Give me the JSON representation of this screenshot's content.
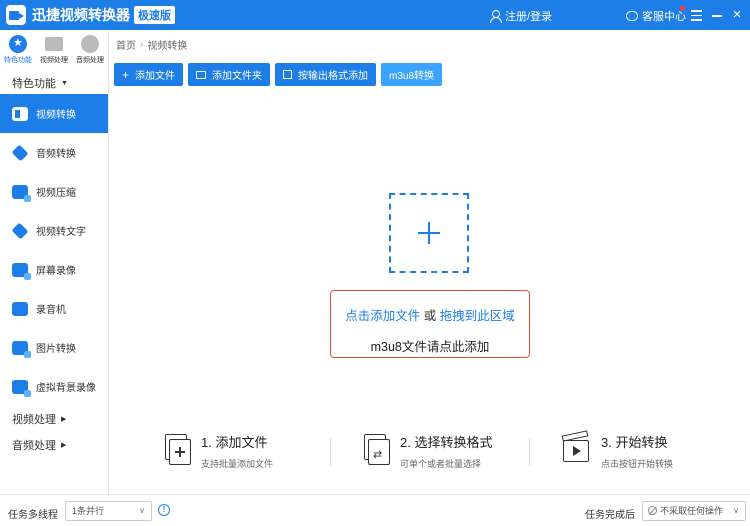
{
  "app": {
    "title": "迅捷视频转换器",
    "edition": "极速版",
    "login": "注册/登录",
    "service": "客服中心",
    "close": "×"
  },
  "sidebar": {
    "top_tabs": [
      {
        "label": "特色功能",
        "active": true
      },
      {
        "label": "视频处理",
        "active": false
      },
      {
        "label": "音频处理",
        "active": false
      }
    ],
    "section_featured": "特色功能",
    "items": [
      {
        "label": "视频转换",
        "icon": "video-convert-icon",
        "active": true
      },
      {
        "label": "音频转换",
        "icon": "audio-convert-icon",
        "active": false
      },
      {
        "label": "视频压缩",
        "icon": "video-compress-icon",
        "active": false
      },
      {
        "label": "视频转文字",
        "icon": "video-to-text-icon",
        "active": false
      },
      {
        "label": "屏幕录像",
        "icon": "screen-record-icon",
        "active": false
      },
      {
        "label": "录音机",
        "icon": "recorder-icon",
        "active": false
      },
      {
        "label": "图片转换",
        "icon": "image-convert-icon",
        "active": false
      },
      {
        "label": "虚拟背景录像",
        "icon": "virtual-background-icon",
        "active": false
      }
    ],
    "section_video": "视频处理",
    "section_audio": "音频处理"
  },
  "breadcrumb": {
    "home": "首页",
    "current": "视频转换"
  },
  "toolbar": {
    "add_file": "添加文件",
    "add_folder": "添加文件夹",
    "add_by_format": "按输出格式添加",
    "m3u8": "m3u8转换"
  },
  "drop": {
    "click_add": "点击添加文件",
    "or": "或",
    "drag_here": "拖拽到此区域",
    "m3u8_hint": "m3u8文件请点此添加"
  },
  "steps": [
    {
      "title": "1. 添加文件",
      "sub": "支持批量添加文件"
    },
    {
      "title": "2. 选择转换格式",
      "sub": "可单个或者批量选择"
    },
    {
      "title": "3. 开始转换",
      "sub": "点击按钮开始转换"
    }
  ],
  "statusbar": {
    "thread_label": "任务多线程",
    "thread_value": "1条并行",
    "after_label": "任务完成后",
    "after_value": "不采取任何操作"
  }
}
